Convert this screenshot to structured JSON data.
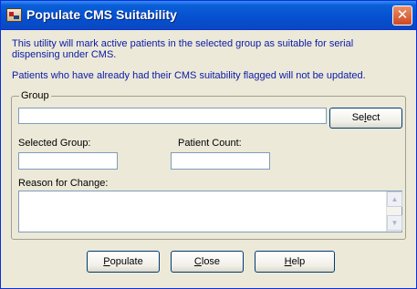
{
  "window": {
    "title": "Populate CMS Suitability",
    "close_glyph": "✕"
  },
  "description": {
    "line1": "This utility will mark active patients in the selected group as suitable for serial dispensing under CMS.",
    "line2": "Patients who have already had their CMS suitability flagged will not be updated."
  },
  "group": {
    "legend": "Group",
    "value": "",
    "select_button": {
      "pre": "Se",
      "accel": "l",
      "post": "ect"
    }
  },
  "selected_group": {
    "label": "Selected Group:",
    "value": ""
  },
  "patient_count": {
    "label": "Patient Count:",
    "value": ""
  },
  "reason": {
    "label": "Reason for Change:",
    "value": ""
  },
  "buttons": {
    "populate": {
      "accel": "P",
      "rest": "opulate"
    },
    "close": {
      "accel": "C",
      "rest": "lose"
    },
    "help": {
      "accel": "H",
      "rest": "elp"
    }
  },
  "colors": {
    "title_bar": "#0550d0",
    "description_text": "#0a1aa8",
    "dialog_bg": "#ece9d8",
    "close_button": "#d04820"
  },
  "icons": {
    "app": "app-icon",
    "close": "close-icon",
    "scroll_up": "scroll-up-icon",
    "scroll_down": "scroll-down-icon"
  }
}
